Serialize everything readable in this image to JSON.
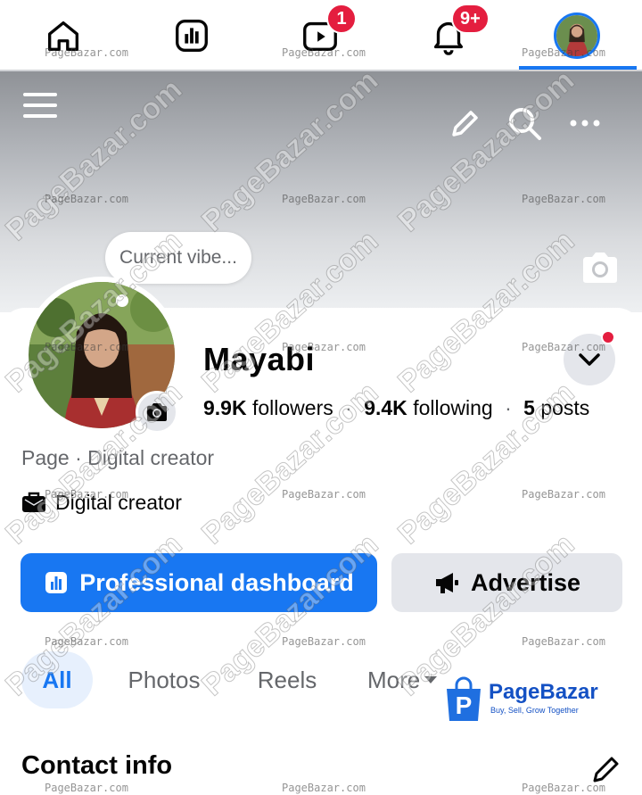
{
  "nav": {
    "tabs": [
      {
        "icon": "home-icon",
        "label": "Home"
      },
      {
        "icon": "dashboard-icon",
        "label": "Dashboard"
      },
      {
        "icon": "video-icon",
        "label": "Video",
        "badge": "1"
      },
      {
        "icon": "bell-icon",
        "label": "Notifications",
        "badge": "9+"
      },
      {
        "icon": "profile-avatar",
        "label": "Profile",
        "active": true
      }
    ]
  },
  "cover": {
    "vibe_placeholder": "Current vibe...",
    "icons": [
      "menu-icon",
      "pencil-icon",
      "search-icon",
      "more-icon",
      "camera-icon"
    ]
  },
  "profile": {
    "name": "Mayabi",
    "followers_num": "9.9K",
    "followers_label": "followers",
    "following_num": "9.4K",
    "following_label": "following",
    "posts_num": "5",
    "posts_label": "posts",
    "category": "Page · Digital creator",
    "detail": "Digital creator"
  },
  "buttons": {
    "dashboard_label": "Professional dashboard",
    "advertise_label": "Advertise"
  },
  "tabs": {
    "all": "All",
    "photos": "Photos",
    "reels": "Reels",
    "more": "More"
  },
  "sections": {
    "contact_title": "Contact info"
  },
  "watermark": {
    "brand_name": "PageBazar",
    "brand_tagline": "Buy, Sell, Grow Together",
    "small_text": "PageBazar.com",
    "diag_text": "PageBazar.com"
  },
  "colors": {
    "accent": "#1877f2",
    "badge": "#e41e3f",
    "secondary_button": "#e4e6eb",
    "text_muted": "#65676b"
  }
}
